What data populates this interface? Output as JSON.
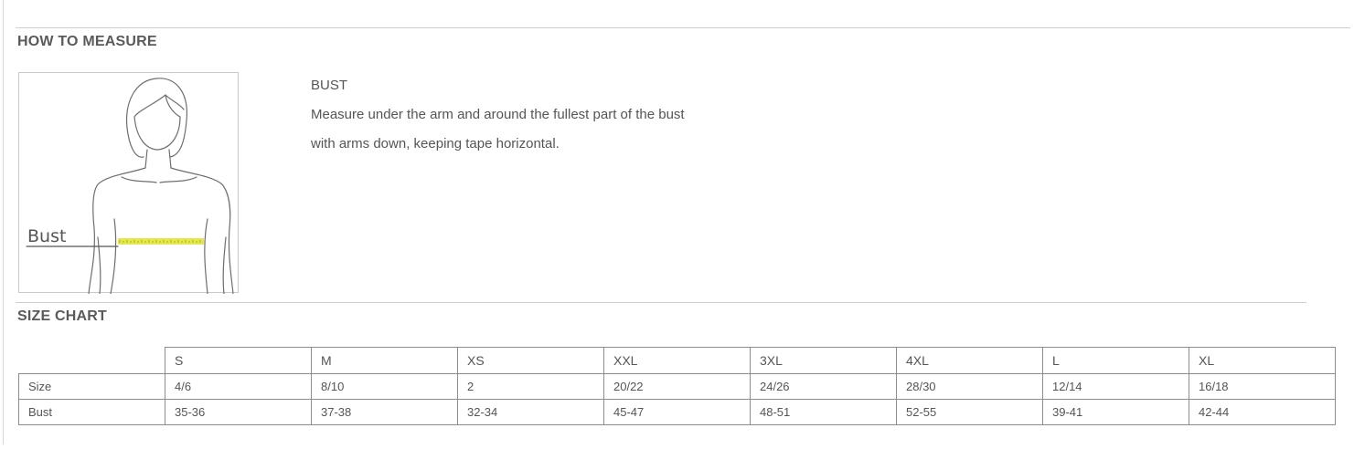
{
  "how_to_measure": {
    "title": "HOW TO MEASURE",
    "figure_label": "Bust",
    "heading": "BUST",
    "description": "Measure under the arm and around the fullest part of the bust\nwith arms down, keeping tape horizontal."
  },
  "size_chart": {
    "title": "SIZE CHART",
    "columns": [
      "S",
      "M",
      "XS",
      "XXL",
      "3XL",
      "4XL",
      "L",
      "XL"
    ],
    "rows": [
      {
        "label": "Size",
        "values": [
          "4/6",
          "8/10",
          "2",
          "20/22",
          "24/26",
          "28/30",
          "12/14",
          "16/18"
        ]
      },
      {
        "label": "Bust",
        "values": [
          "35-36",
          "37-38",
          "32-34",
          "45-47",
          "48-51",
          "52-55",
          "39-41",
          "42-44"
        ]
      }
    ]
  },
  "colors": {
    "tape": "#e6e84a",
    "rule": "#cfcfcf",
    "text": "#555555"
  }
}
